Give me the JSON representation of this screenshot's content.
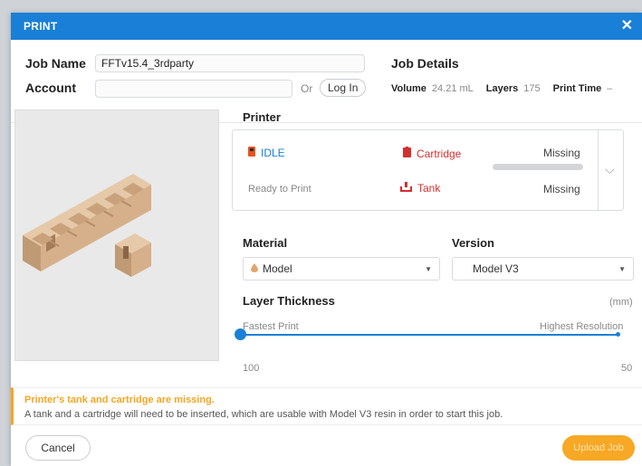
{
  "dialog": {
    "title": "PRINT"
  },
  "job": {
    "name_label": "Job Name",
    "name_value": "FFTv15.4_3rdparty",
    "account_label": "Account",
    "account_value": "",
    "or_text": "Or",
    "login_label": "Log In"
  },
  "job_details": {
    "title": "Job Details",
    "volume_label": "Volume",
    "volume_value": "24.21 mL",
    "layers_label": "Layers",
    "layers_value": "175",
    "print_time_label": "Print Time",
    "print_time_value": "–"
  },
  "printer": {
    "title": "Printer",
    "status": "IDLE",
    "status_detail": "Ready to Print",
    "cartridge_label": "Cartridge",
    "cartridge_status": "Missing",
    "tank_label": "Tank",
    "tank_status": "Missing"
  },
  "material": {
    "title": "Material",
    "selected": "Model"
  },
  "version": {
    "title": "Version",
    "selected": "Model V3"
  },
  "layer_thickness": {
    "title": "Layer Thickness",
    "unit": "(mm)",
    "left_label": "Fastest Print",
    "right_label": "Highest Resolution",
    "min_value": "100",
    "max_value": "50",
    "slider_position": 0
  },
  "warning": {
    "title": "Printer's tank and cartridge are missing.",
    "text": "A tank and a cartridge will need to be inserted, which are usable with Model V3 resin in order to start this job."
  },
  "buttons": {
    "cancel": "Cancel",
    "upload": "Upload Job"
  },
  "colors": {
    "accent": "#1a7fd6",
    "warning": "#f5a623",
    "error": "#d32f2f"
  }
}
